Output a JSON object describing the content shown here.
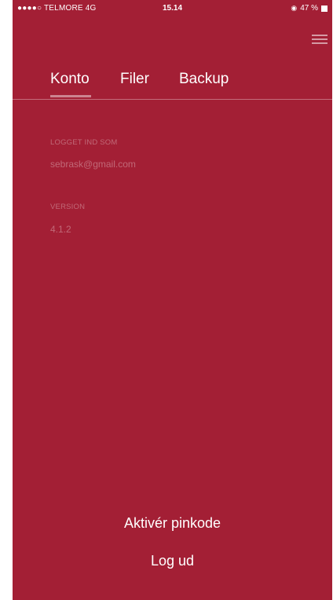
{
  "status_bar": {
    "carrier": "●●●●○ TELMORE  4G",
    "time": "15.14",
    "battery_text": "47 %",
    "lock_glyph": "◉"
  },
  "tabs": [
    {
      "label": "Konto",
      "active": true
    },
    {
      "label": "Filer",
      "active": false
    },
    {
      "label": "Backup",
      "active": false
    }
  ],
  "account": {
    "logged_in_label": "LOGGET IND SOM",
    "email": "sebrask@gmail.com",
    "version_label": "VERSION",
    "version": "4.1.2"
  },
  "actions": {
    "activate_pin": "Aktivér pinkode",
    "logout": "Log ud"
  },
  "colors": {
    "background": "#a31f35",
    "text": "#ffffff"
  },
  "icons": {
    "menu": "hamburger-icon",
    "battery": "battery-icon",
    "orientation_lock": "orientation-lock-icon"
  }
}
